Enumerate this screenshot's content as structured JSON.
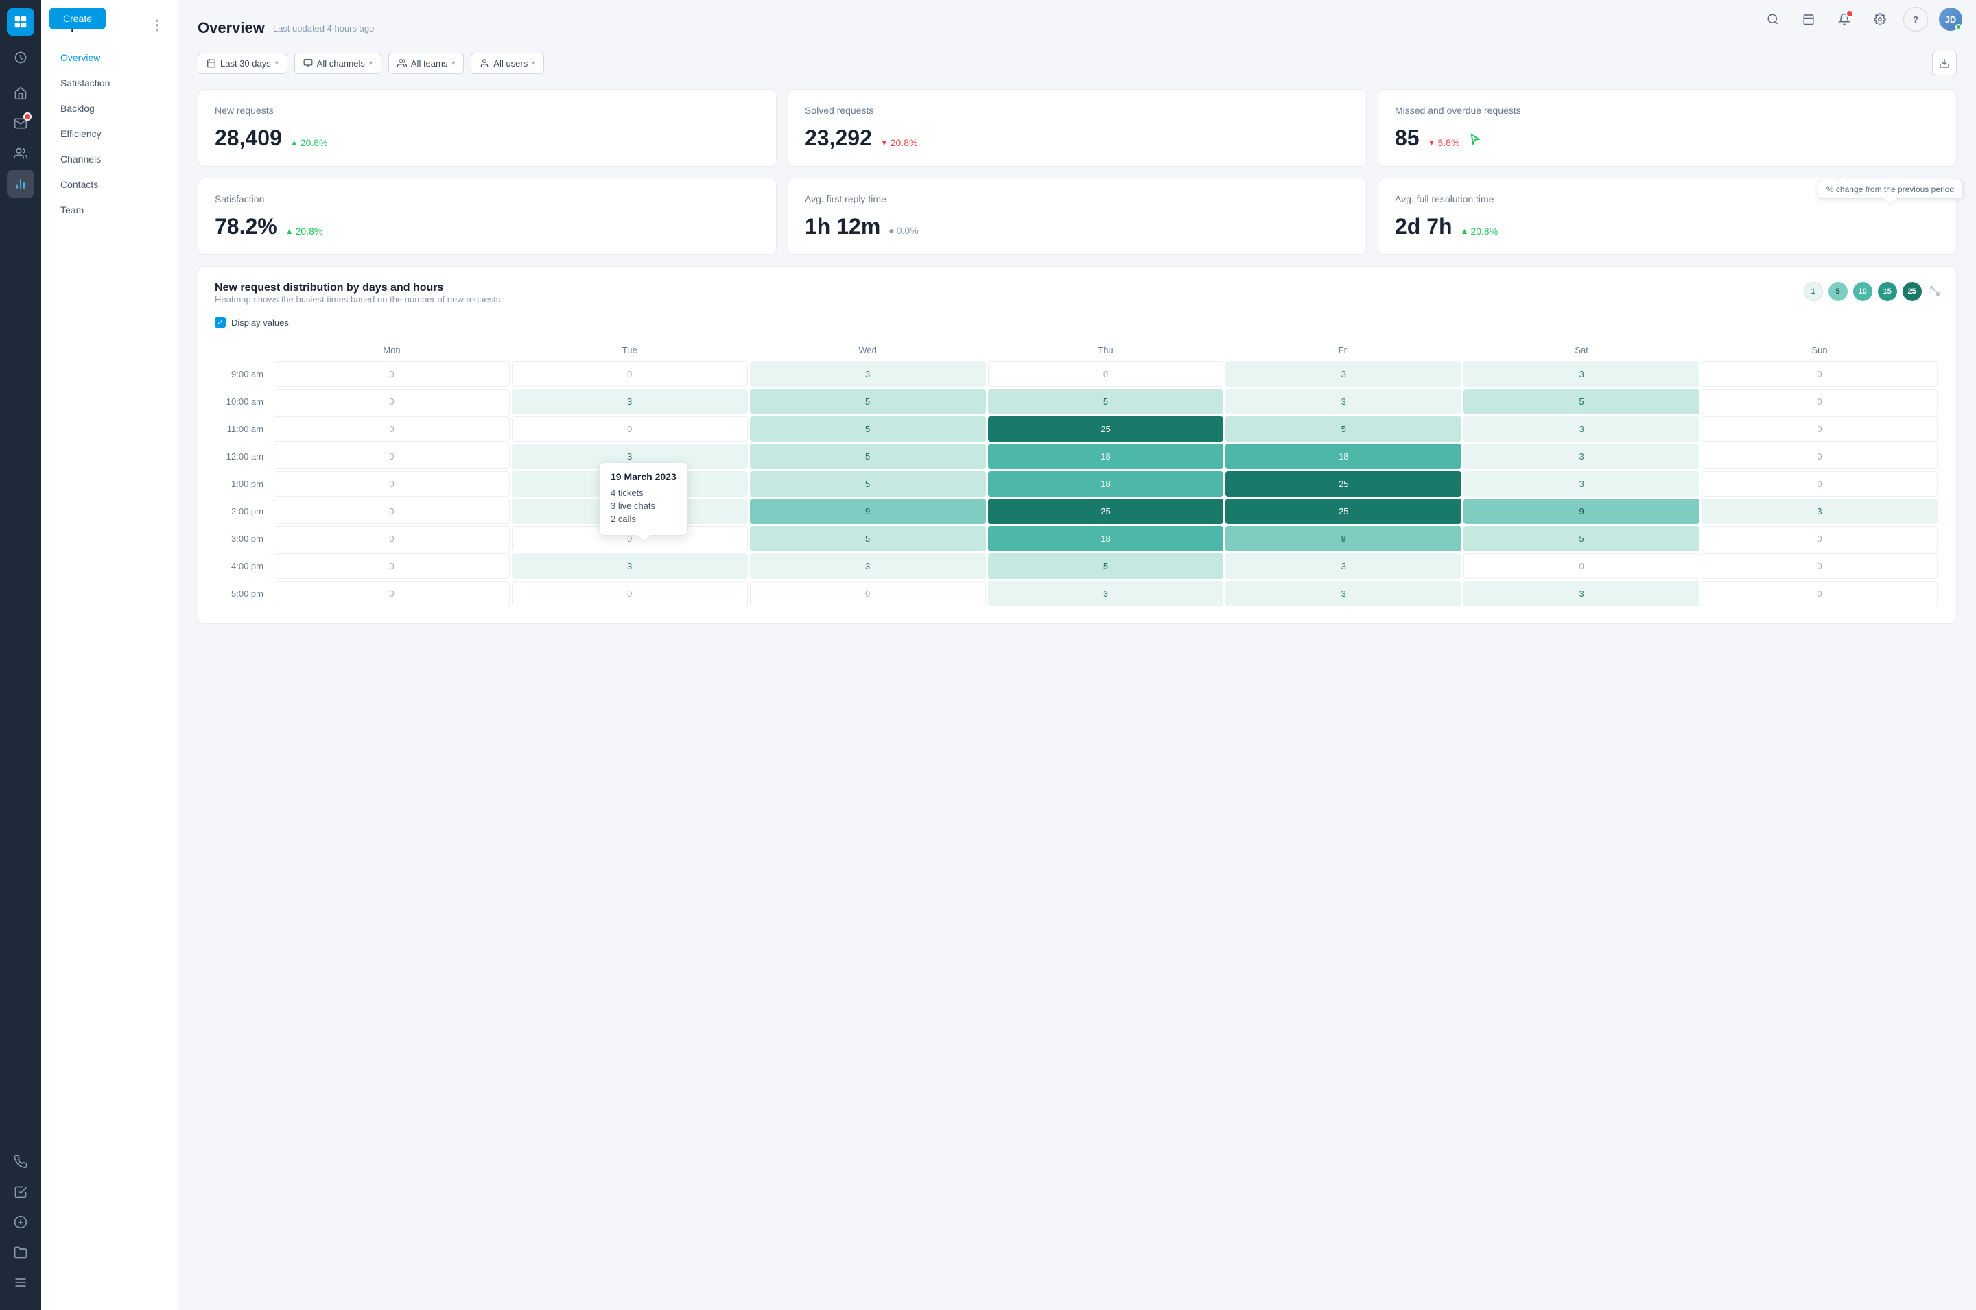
{
  "app": {
    "create_button": "Create"
  },
  "nav": {
    "icons": [
      {
        "name": "home-icon",
        "symbol": "⌂",
        "active": false
      },
      {
        "name": "inbox-icon",
        "symbol": "✉",
        "active": false
      },
      {
        "name": "notifications-icon",
        "symbol": "🔔",
        "active": false
      },
      {
        "name": "contacts-icon",
        "symbol": "👤",
        "active": false
      },
      {
        "name": "reports-icon",
        "symbol": "📊",
        "active": true
      },
      {
        "name": "announcements-icon",
        "symbol": "📢",
        "active": false
      },
      {
        "name": "tasks-icon",
        "symbol": "☑",
        "active": false
      },
      {
        "name": "billing-icon",
        "symbol": "💲",
        "active": false
      },
      {
        "name": "files-icon",
        "symbol": "📁",
        "active": false
      },
      {
        "name": "history-icon",
        "symbol": "↺",
        "active": false
      }
    ]
  },
  "sidebar": {
    "title": "Reports",
    "more_label": "⋮",
    "items": [
      {
        "label": "Overview",
        "active": true
      },
      {
        "label": "Satisfaction",
        "active": false
      },
      {
        "label": "Backlog",
        "active": false
      },
      {
        "label": "Efficiency",
        "active": false
      },
      {
        "label": "Channels",
        "active": false
      },
      {
        "label": "Contacts",
        "active": false
      },
      {
        "label": "Team",
        "active": false
      }
    ]
  },
  "header": {
    "title": "Overview",
    "last_updated": "Last updated 4 hours ago",
    "download_icon": "⬇"
  },
  "filters": {
    "date_range": {
      "icon": "📅",
      "label": "Last 30 days",
      "chevron": "▾"
    },
    "channels": {
      "icon": "⬜",
      "label": "All channels",
      "chevron": "▾"
    },
    "teams": {
      "icon": "👥",
      "label": "All teams",
      "chevron": "▾"
    },
    "users": {
      "icon": "👤",
      "label": "All users",
      "chevron": "▾"
    }
  },
  "stat_cards": [
    {
      "id": "new-requests",
      "label": "New requests",
      "value": "28,409",
      "change": "20.8%",
      "change_direction": "up",
      "change_arrow": "▲"
    },
    {
      "id": "solved-requests",
      "label": "Solved requests",
      "value": "23,292",
      "change": "20.8%",
      "change_direction": "down",
      "change_arrow": "▼"
    },
    {
      "id": "missed-requests",
      "label": "Missed and overdue requests",
      "value": "85",
      "change": "5.8%",
      "change_direction": "down",
      "change_arrow": "▼",
      "tooltip": "% change from the previous period"
    }
  ],
  "stat_cards_row2": [
    {
      "id": "satisfaction",
      "label": "Satisfaction",
      "value": "78.2%",
      "change": "20.8%",
      "change_direction": "up",
      "change_arrow": "▲"
    },
    {
      "id": "avg-first-reply",
      "label": "Avg. first reply time",
      "value": "1h 12m",
      "change": "0.0%",
      "change_direction": "neutral",
      "change_symbol": "●"
    },
    {
      "id": "avg-resolution",
      "label": "Avg. full resolution time",
      "value": "2d 7h",
      "change": "20.8%",
      "change_direction": "up",
      "change_arrow": "▲"
    }
  ],
  "heatmap": {
    "title": "New request distribution by days and hours",
    "subtitle": "Heatmap shows the busiest times based on the number of new requests",
    "display_values_label": "Display values",
    "legend": [
      {
        "value": "1",
        "color": "#e8f5f2",
        "text_color": "#3a7a6e"
      },
      {
        "value": "5",
        "color": "#7ecdc0",
        "text_color": "#1a5a50"
      },
      {
        "value": "10",
        "color": "#4db8a8",
        "text_color": "#fff"
      },
      {
        "value": "15",
        "color": "#2a9987",
        "text_color": "#fff"
      },
      {
        "value": "25",
        "color": "#1a7a6a",
        "text_color": "#fff"
      }
    ],
    "days": [
      "Mon",
      "Tue",
      "Wed",
      "Thu",
      "Fri",
      "Sat",
      "Sun"
    ],
    "rows": [
      {
        "time": "9:00 am",
        "values": [
          0,
          0,
          3,
          0,
          3,
          3,
          0
        ],
        "heat": [
          0,
          0,
          1,
          0,
          1,
          1,
          0
        ]
      },
      {
        "time": "10:00 am",
        "values": [
          0,
          3,
          5,
          5,
          3,
          5,
          0
        ],
        "heat": [
          0,
          1,
          2,
          2,
          1,
          2,
          0
        ]
      },
      {
        "time": "11:00 am",
        "values": [
          0,
          0,
          5,
          25,
          5,
          3,
          0
        ],
        "heat": [
          0,
          0,
          2,
          6,
          2,
          1,
          0
        ]
      },
      {
        "time": "12:00 am",
        "values": [
          0,
          3,
          5,
          18,
          18,
          3,
          0
        ],
        "heat": [
          0,
          1,
          2,
          4,
          4,
          1,
          0
        ]
      },
      {
        "time": "1:00 pm",
        "values": [
          0,
          3,
          5,
          18,
          25,
          3,
          0
        ],
        "heat": [
          0,
          1,
          2,
          4,
          6,
          1,
          0
        ]
      },
      {
        "time": "2:00 pm",
        "values": [
          0,
          3,
          9,
          25,
          25,
          9,
          3
        ],
        "heat": [
          0,
          1,
          3,
          6,
          6,
          3,
          1
        ]
      },
      {
        "time": "3:00 pm",
        "values": [
          0,
          0,
          5,
          18,
          9,
          5,
          0
        ],
        "heat": [
          0,
          0,
          2,
          4,
          3,
          2,
          0
        ]
      },
      {
        "time": "4:00 pm",
        "values": [
          0,
          3,
          3,
          5,
          3,
          0,
          0
        ],
        "heat": [
          0,
          1,
          1,
          2,
          1,
          0,
          0
        ]
      },
      {
        "time": "5:00 pm",
        "values": [
          0,
          0,
          0,
          3,
          3,
          3,
          0
        ],
        "heat": [
          0,
          0,
          0,
          1,
          1,
          1,
          0
        ]
      }
    ],
    "tooltip": {
      "date": "19 March 2023",
      "tickets": "4 tickets",
      "live_chats": "3 live chats",
      "calls": "2 calls"
    }
  },
  "top_header": {
    "search_icon": "🔍",
    "calendar_icon": "📅",
    "notification_icon": "🔔",
    "settings_icon": "⚙",
    "help_icon": "?"
  }
}
